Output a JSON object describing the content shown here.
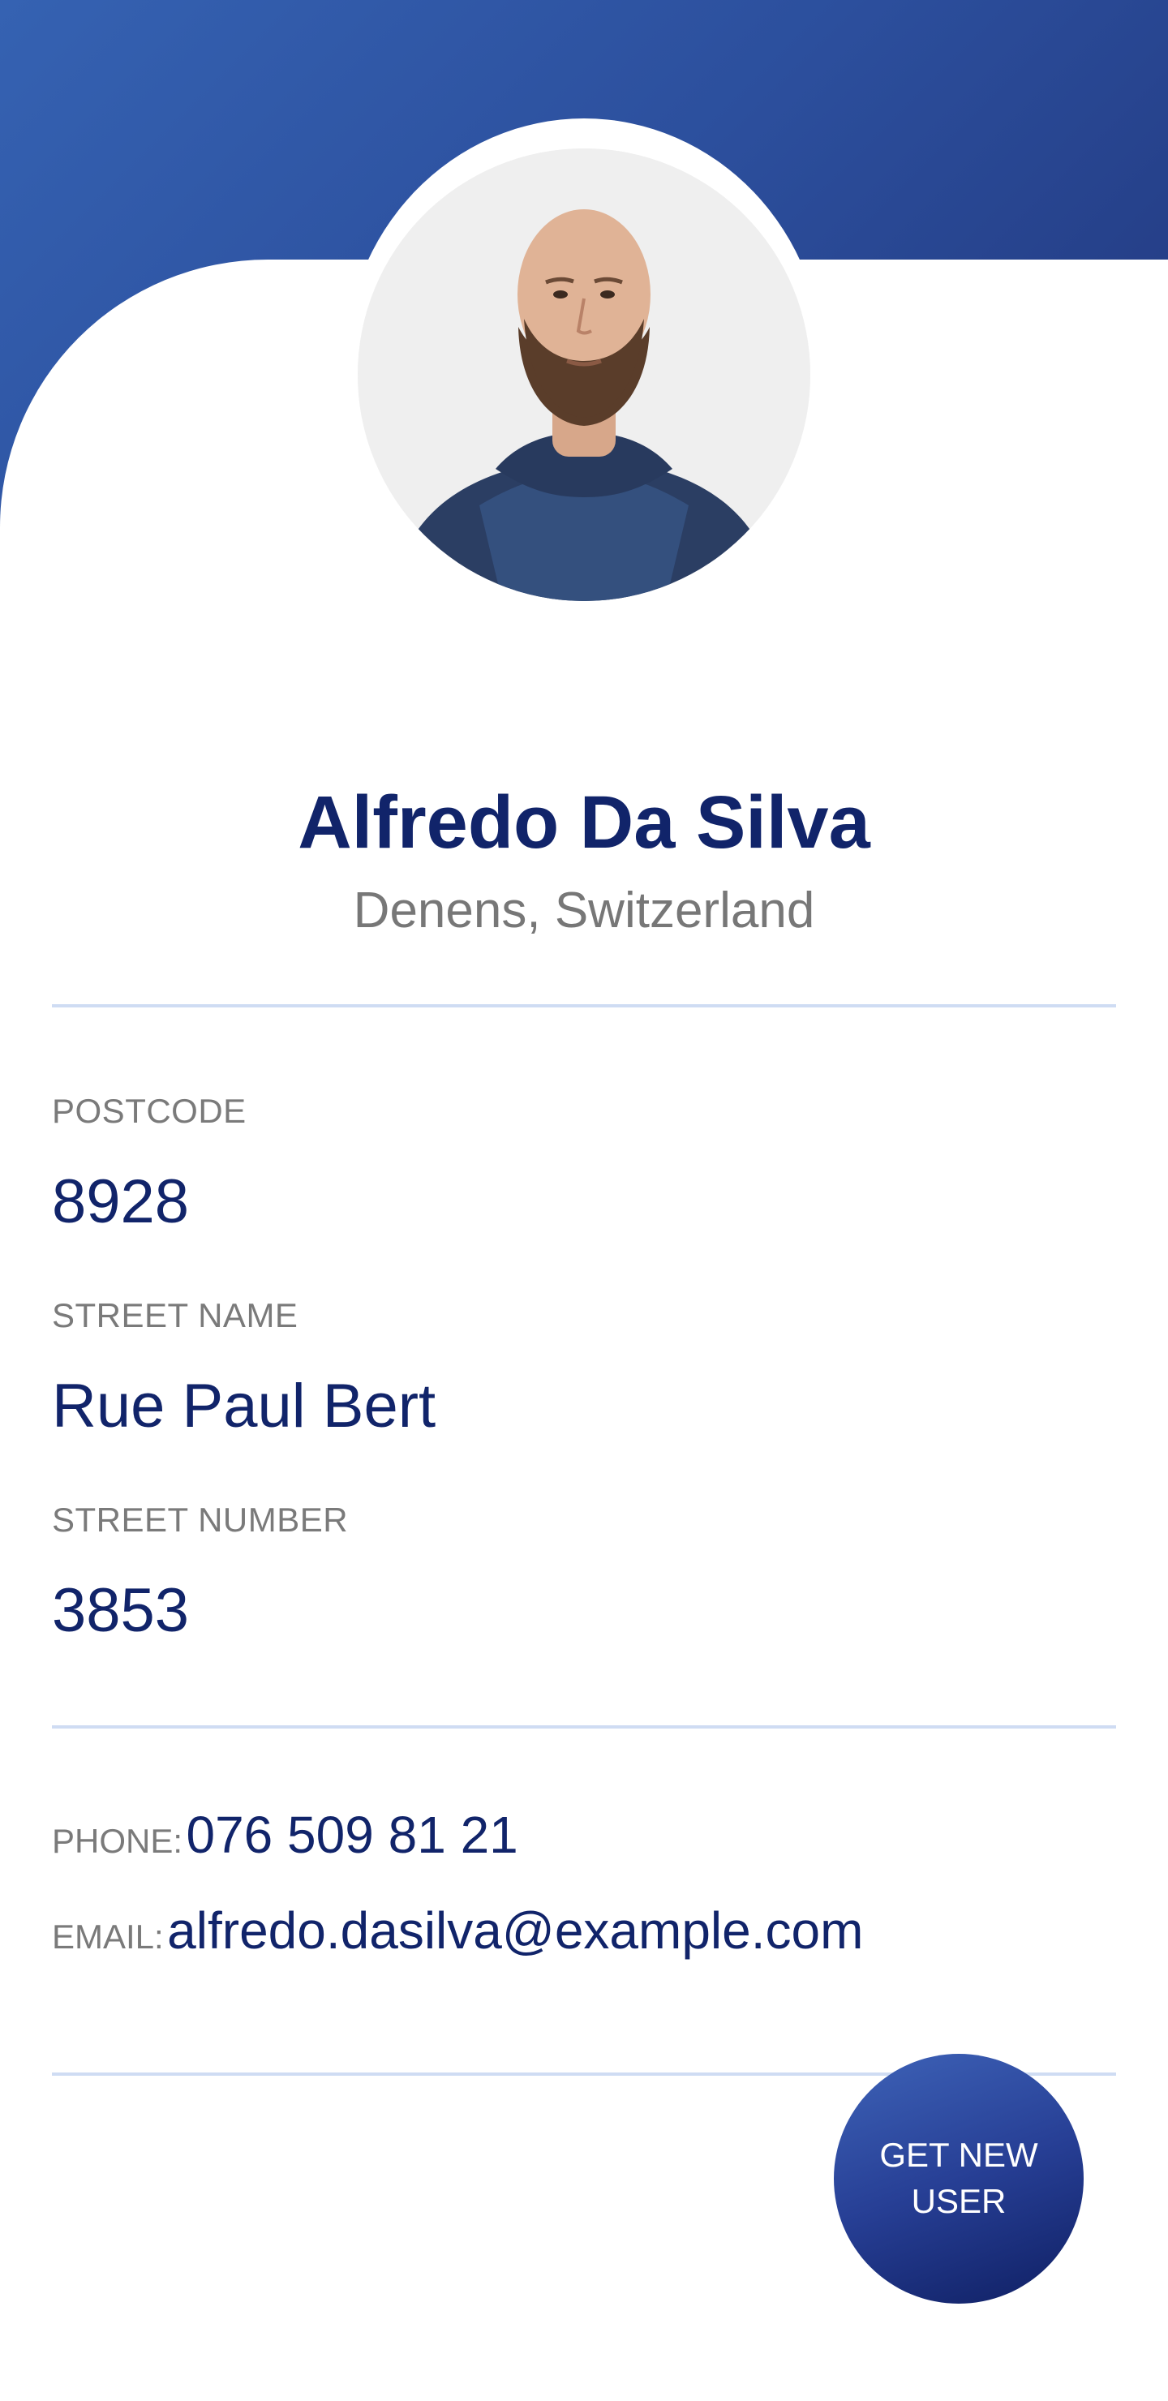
{
  "theme": {
    "accent": "#2c4f9d",
    "text_primary": "#11246a",
    "text_muted": "#777777",
    "divider": "#cfdcf3"
  },
  "profile": {
    "name": "Alfredo Da Silva",
    "location": "Denens, Switzerland",
    "avatar_icon": "user-photo"
  },
  "address": {
    "postcode_label": "POSTCODE",
    "postcode": "8928",
    "street_name_label": "STREET NAME",
    "street_name": "Rue Paul Bert",
    "street_number_label": "STREET NUMBER",
    "street_number": "3853"
  },
  "contact": {
    "phone_label": "PHONE:",
    "phone": "076 509 81 21",
    "email_label": "EMAIL:",
    "email": "alfredo.dasilva@example.com"
  },
  "actions": {
    "new_user_line1": "GET NEW",
    "new_user_line2": "USER"
  }
}
